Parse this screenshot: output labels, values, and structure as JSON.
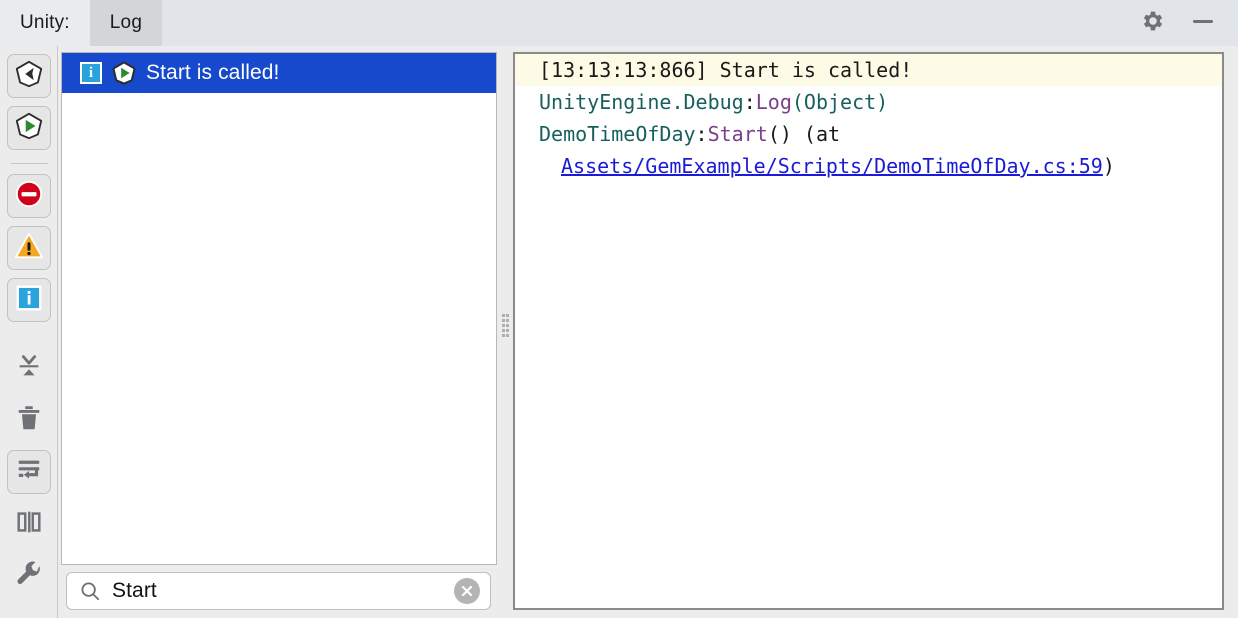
{
  "window": {
    "tabs": [
      {
        "label": "Unity:",
        "name": "tab-unity",
        "selected": false
      },
      {
        "label": "Log",
        "name": "tab-log",
        "selected": true
      }
    ],
    "actions": [
      {
        "label": "Settings",
        "icon": "gear-icon"
      },
      {
        "label": "Minimize",
        "icon": "minimize-icon"
      }
    ]
  },
  "toolbar": {
    "buttons": [
      {
        "icon": "unity-logo-icon",
        "label": "Unity",
        "active": true
      },
      {
        "icon": "play-pentagon-icon",
        "label": "Play",
        "active": true
      },
      {
        "icon": "error-stop-icon",
        "label": "Errors",
        "active": true
      },
      {
        "icon": "warning-triangle-icon",
        "label": "Warnings",
        "active": true
      },
      {
        "icon": "info-badge-icon",
        "label": "Info",
        "active": true
      },
      {
        "icon": "collapse-icon",
        "label": "Collapse",
        "active": false
      },
      {
        "icon": "trash-icon",
        "label": "Clear",
        "active": false
      },
      {
        "icon": "soft-wrap-icon",
        "label": "Soft Wrap",
        "active": true
      },
      {
        "icon": "split-view-icon",
        "label": "Split View",
        "active": false
      },
      {
        "icon": "wrench-icon",
        "label": "Configure",
        "active": false
      }
    ]
  },
  "log_list": {
    "rows": [
      {
        "selected": true,
        "status_icon": "info-badge-icon",
        "source_icon": "play-pentagon-icon",
        "message": "Start is called!"
      }
    ]
  },
  "search": {
    "value": "Start",
    "placeholder": "Search",
    "icon": "search-icon",
    "clear_icon": "close-circle-icon"
  },
  "detail": {
    "timestamp_line": "[13:13:13:866] Start is called!",
    "stack": {
      "line2_ns": "UnityEngine.Debug",
      "line2_colon": ":",
      "line2_member": "Log",
      "line2_args": "(Object)",
      "line3_type": "DemoTimeOfDay",
      "line3_colon": ":",
      "line3_member": "Start",
      "line3_tail": "() (at",
      "line4_link": "Assets/GemExample/Scripts/DemoTimeOfDay.cs:59",
      "line4_tail": ")"
    }
  },
  "colors": {
    "selection": "#1649CB",
    "highlight": "#FDFAE6",
    "link": "#1B1BD6",
    "type": "#18605E",
    "member": "#7C3E8E",
    "info": "#29A3DC",
    "warning": "#F5A623",
    "error": "#D0021B"
  }
}
